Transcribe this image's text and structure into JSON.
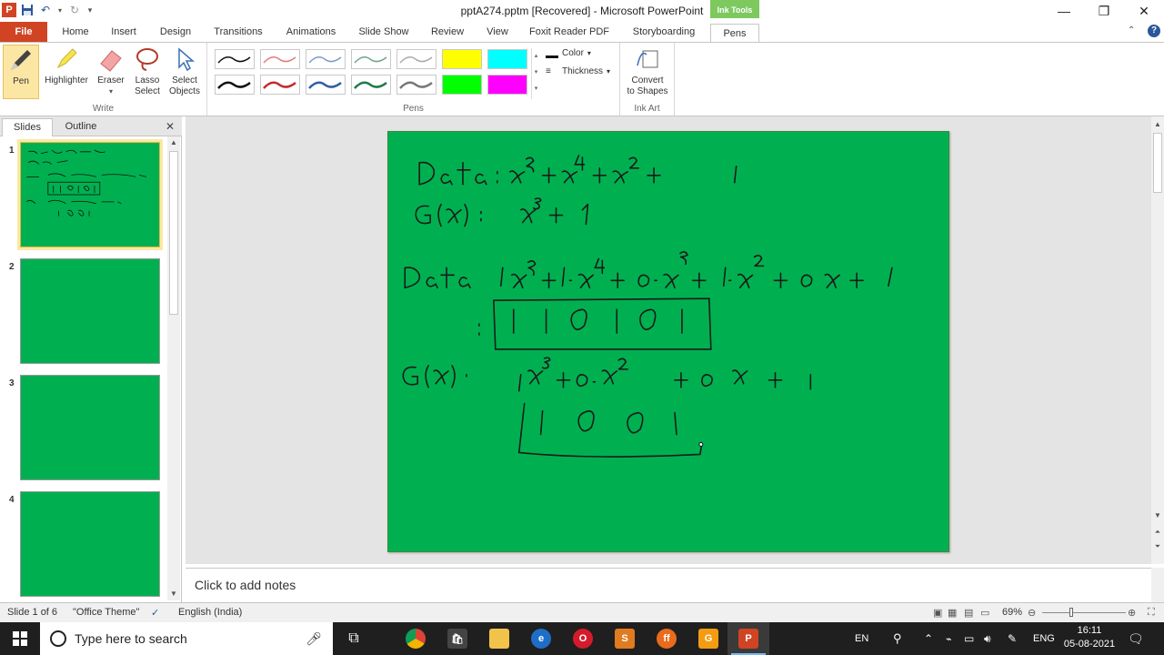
{
  "window": {
    "title": "pptA274.pptm [Recovered] - Microsoft PowerPoint",
    "contextual_tab_group": "Ink Tools"
  },
  "tabs": [
    {
      "label": "File"
    },
    {
      "label": "Home"
    },
    {
      "label": "Insert"
    },
    {
      "label": "Design"
    },
    {
      "label": "Transitions"
    },
    {
      "label": "Animations"
    },
    {
      "label": "Slide Show"
    },
    {
      "label": "Review"
    },
    {
      "label": "View"
    },
    {
      "label": "Foxit Reader PDF"
    },
    {
      "label": "Storyboarding"
    },
    {
      "label": "Pens"
    }
  ],
  "ribbon": {
    "write": {
      "label": "Write",
      "pen": "Pen",
      "highlighter": "Highlighter",
      "eraser": "Eraser",
      "lasso_1": "Lasso",
      "lasso_2": "Select",
      "select_1": "Select",
      "select_2": "Objects"
    },
    "pens": {
      "label": "Pens",
      "color": "Color",
      "thickness": "Thickness"
    },
    "ink_art": {
      "label": "Ink Art",
      "convert_1": "Convert",
      "convert_2": "to Shapes"
    }
  },
  "colors": {
    "slide_bg": "#00b050",
    "file_tab": "#d04423",
    "ink_tools": "#7dc95e"
  },
  "left_panel": {
    "tab_slides": "Slides",
    "tab_outline": "Outline",
    "slides": [
      {
        "number": "1"
      },
      {
        "number": "2"
      },
      {
        "number": "3"
      },
      {
        "number": "4"
      }
    ]
  },
  "notes": {
    "placeholder": "Click to add notes"
  },
  "status": {
    "slide": "Slide 1 of 6",
    "theme": "\"Office Theme\"",
    "language": "English (India)",
    "zoom": "69%"
  },
  "taskbar": {
    "search_placeholder": "Type here to search",
    "lang_en": "EN",
    "lang_eng": "ENG",
    "time": "16:11",
    "date": "05-08-2021"
  }
}
